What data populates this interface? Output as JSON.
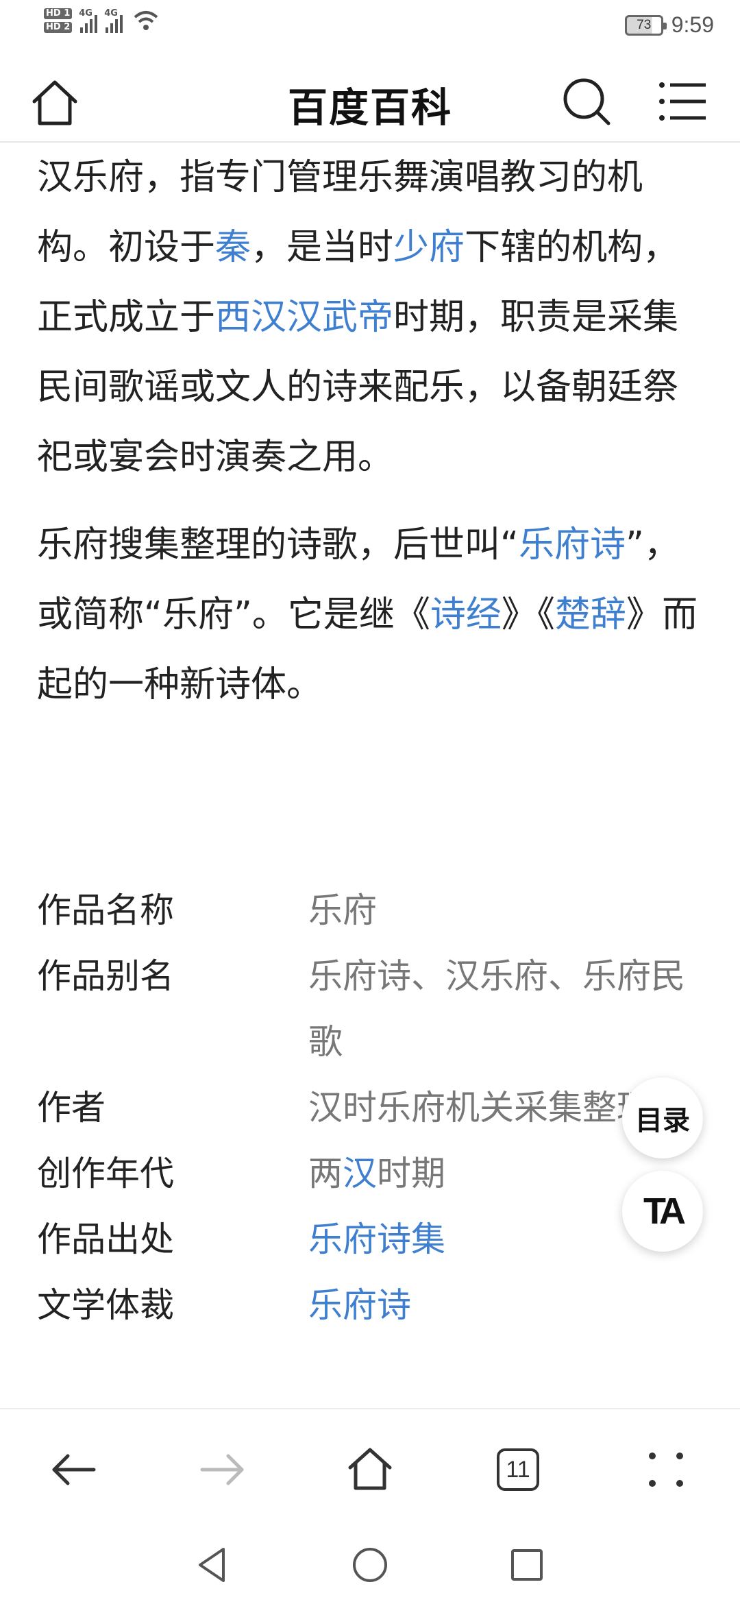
{
  "status_bar": {
    "sim1": "HD 1",
    "sim2": "HD 2",
    "network1": "4G",
    "network2": "4G",
    "battery_level": "73",
    "time": "9:59"
  },
  "header": {
    "title": "百度百科"
  },
  "article": {
    "paragraph1": [
      {
        "text": "汉乐府，指专门管理乐舞演唱教习的机构。初设于",
        "link": false
      },
      {
        "text": "秦",
        "link": true
      },
      {
        "text": "，是当时",
        "link": false
      },
      {
        "text": "少府",
        "link": true
      },
      {
        "text": "下辖的机构，正式成立于",
        "link": false
      },
      {
        "text": "西汉",
        "link": true
      },
      {
        "text": "汉武帝",
        "link": true
      },
      {
        "text": "时期，职责是采集民间歌谣或文人的诗来配乐，以备朝廷祭祀或宴会时演奏之用。",
        "link": false
      }
    ],
    "paragraph2": [
      {
        "text": "乐府搜集整理的诗歌，后世叫“",
        "link": false
      },
      {
        "text": "乐府诗",
        "link": true
      },
      {
        "text": "”，或简称“乐府”。它是继《",
        "link": false
      },
      {
        "text": "诗经",
        "link": true
      },
      {
        "text": "》《",
        "link": false
      },
      {
        "text": "楚辞",
        "link": true
      },
      {
        "text": "》而起的一种新诗体。",
        "link": false
      }
    ]
  },
  "info_table": [
    {
      "key": "作品名称",
      "value": [
        {
          "text": "乐府",
          "link": false
        }
      ]
    },
    {
      "key": "作品别名",
      "value": [
        {
          "text": "乐府诗、汉乐府、乐府民歌",
          "link": false
        }
      ]
    },
    {
      "key": "作者",
      "value": [
        {
          "text": "汉时乐府机关采集整理",
          "link": false
        }
      ]
    },
    {
      "key": "创作年代",
      "value": [
        {
          "text": "两",
          "link": false
        },
        {
          "text": "汉",
          "link": true
        },
        {
          "text": "时期",
          "link": false
        }
      ]
    },
    {
      "key": "作品出处",
      "value": [
        {
          "text": "乐府诗集",
          "link": true
        }
      ]
    },
    {
      "key": "文学体裁",
      "value": [
        {
          "text": "乐府诗",
          "link": true
        }
      ]
    }
  ],
  "floating": {
    "toc_label": "目录",
    "ta_label": "TA"
  },
  "browser_bar": {
    "tab_count": "11"
  },
  "colors": {
    "link": "#3f7fd0",
    "text": "#222222",
    "secondary": "#777777"
  }
}
